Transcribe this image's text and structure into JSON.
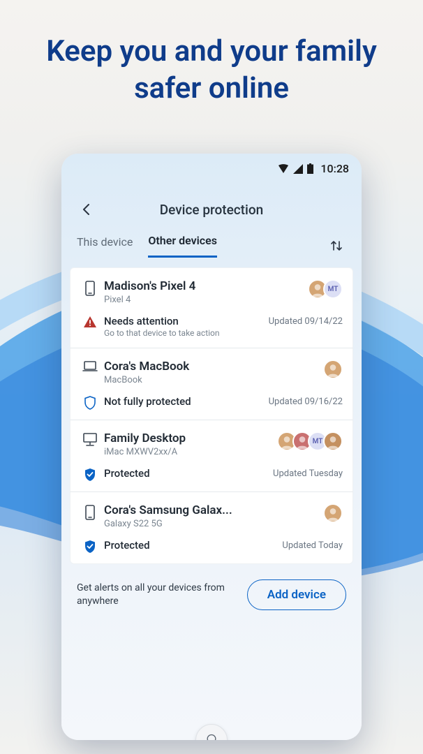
{
  "headline": "Keep you and your family safer online",
  "status_bar": {
    "time": "10:28"
  },
  "topbar": {
    "title": "Device protection"
  },
  "tabs": {
    "this_device": "This device",
    "other_devices": "Other devices"
  },
  "devices": [
    {
      "name": "Madison's Pixel 4",
      "model": "Pixel 4",
      "icon": "phone",
      "status": "needs-attention",
      "status_label": "Needs attention",
      "status_sub": "Go to that device to take action",
      "updated": "Updated 09/14/22",
      "avatars": [
        {
          "type": "photo",
          "bg": "#d4a574"
        },
        {
          "type": "initials",
          "text": "MT",
          "bg": "#dcdff5",
          "color": "#5a5fb0"
        }
      ]
    },
    {
      "name": "Cora's MacBook",
      "model": "MacBook",
      "icon": "laptop",
      "status": "not-protected",
      "status_label": "Not fully protected",
      "status_sub": "",
      "updated": "Updated 09/16/22",
      "avatars": [
        {
          "type": "photo",
          "bg": "#d4a574"
        }
      ]
    },
    {
      "name": "Family Desktop",
      "model": "iMac MXWV2xx/A",
      "icon": "desktop",
      "status": "protected",
      "status_label": "Protected",
      "status_sub": "",
      "updated": "Updated Tuesday",
      "avatars": [
        {
          "type": "photo",
          "bg": "#d4a574"
        },
        {
          "type": "photo",
          "bg": "#c97070"
        },
        {
          "type": "initials",
          "text": "MT",
          "bg": "#dcdff5",
          "color": "#5a5fb0"
        },
        {
          "type": "photo",
          "bg": "#c49060"
        }
      ]
    },
    {
      "name": "Cora's Samsung Galax...",
      "model": "Galaxy S22 5G",
      "icon": "phone",
      "status": "protected",
      "status_label": "Protected",
      "status_sub": "",
      "updated": "Updated Today",
      "avatars": [
        {
          "type": "photo",
          "bg": "#d4a574"
        }
      ]
    }
  ],
  "footer": {
    "text": "Get alerts on all your devices from anywhere",
    "button": "Add device"
  }
}
